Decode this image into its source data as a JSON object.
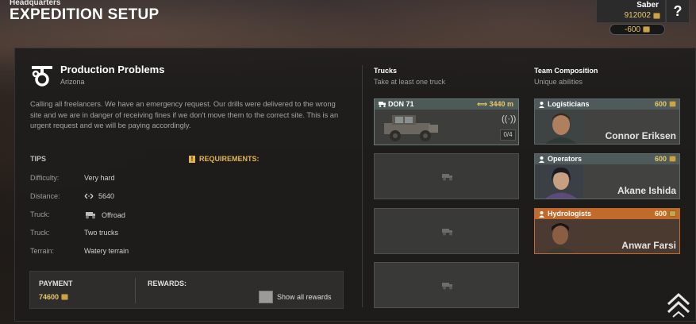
{
  "header": {
    "breadcrumb": "Headquarters",
    "title": "EXPEDITION SETUP",
    "user_name": "Saber",
    "money": "912002",
    "cost": "-600",
    "help_label": "?"
  },
  "mission": {
    "title": "Production Problems",
    "location": "Arizona",
    "description": "Calling all freelancers. We have an emergency request. Our drills were delivered to the wrong site and we are in danger of receiving fines if we don't move them to the correct site. This is an urgent request and we will be paying accordingly.",
    "tips_heading": "TIPS",
    "requirements_heading": "REQUIREMENTS:",
    "tips": [
      {
        "label": "Difficulty:",
        "value": "Very hard",
        "icon": ""
      },
      {
        "label": "Distance:",
        "value": "5640",
        "icon": "distance-icon"
      },
      {
        "label": "Truck:",
        "value": "Offroad",
        "icon": "offroad-truck-icon"
      },
      {
        "label": "Truck:",
        "value": "Two trucks",
        "icon": ""
      },
      {
        "label": "Terrain:",
        "value": "Watery terrain",
        "icon": ""
      }
    ]
  },
  "payment": {
    "label": "PAYMENT",
    "value": "74600",
    "rewards_label": "REWARDS:",
    "show_all_label": "Show all rewards"
  },
  "trucks": {
    "heading": "Trucks",
    "subheading": "Take at least one truck",
    "selected": {
      "name": "DON 71",
      "distance": "3440 m",
      "capacity": "0/4"
    },
    "empty_slots": 3
  },
  "team": {
    "heading": "Team Composition",
    "subheading": "Unique abilities",
    "members": [
      {
        "role": "Logisticians",
        "cost": "600",
        "name": "Connor Eriksen",
        "highlight": false
      },
      {
        "role": "Operators",
        "cost": "600",
        "name": "Akane Ishida",
        "highlight": false
      },
      {
        "role": "Hydrologists",
        "cost": "600",
        "name": "Anwar Farsi",
        "highlight": true
      }
    ]
  },
  "colors": {
    "gold": "#e8c766",
    "highlight_orange": "#c26a2c",
    "card_header": "#4f5b5a"
  }
}
